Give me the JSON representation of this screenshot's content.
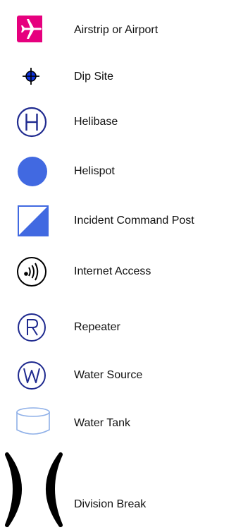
{
  "legend": {
    "items": [
      {
        "icon": "airplane-icon",
        "label": "Airstrip or Airport"
      },
      {
        "icon": "crosshair-dot-icon",
        "label": "Dip Site"
      },
      {
        "icon": "circled-h-icon",
        "label": "Helibase"
      },
      {
        "icon": "filled-circle-icon",
        "label": "Helispot"
      },
      {
        "icon": "half-filled-square-icon",
        "label": "Incident Command Post"
      },
      {
        "icon": "wifi-signal-circle-icon",
        "label": "Internet Access"
      },
      {
        "icon": "circled-r-icon",
        "label": "Repeater"
      },
      {
        "icon": "circled-w-icon",
        "label": "Water Source"
      },
      {
        "icon": "tank-cylinder-icon",
        "label": "Water Tank"
      },
      {
        "icon": "division-break-icon",
        "label": "Division Break"
      }
    ]
  },
  "colors": {
    "magenta": "#e6007e",
    "navy": "#1f2a8f",
    "blue": "#4169e1",
    "light_blue": "#8fb0e8",
    "black": "#000000"
  }
}
